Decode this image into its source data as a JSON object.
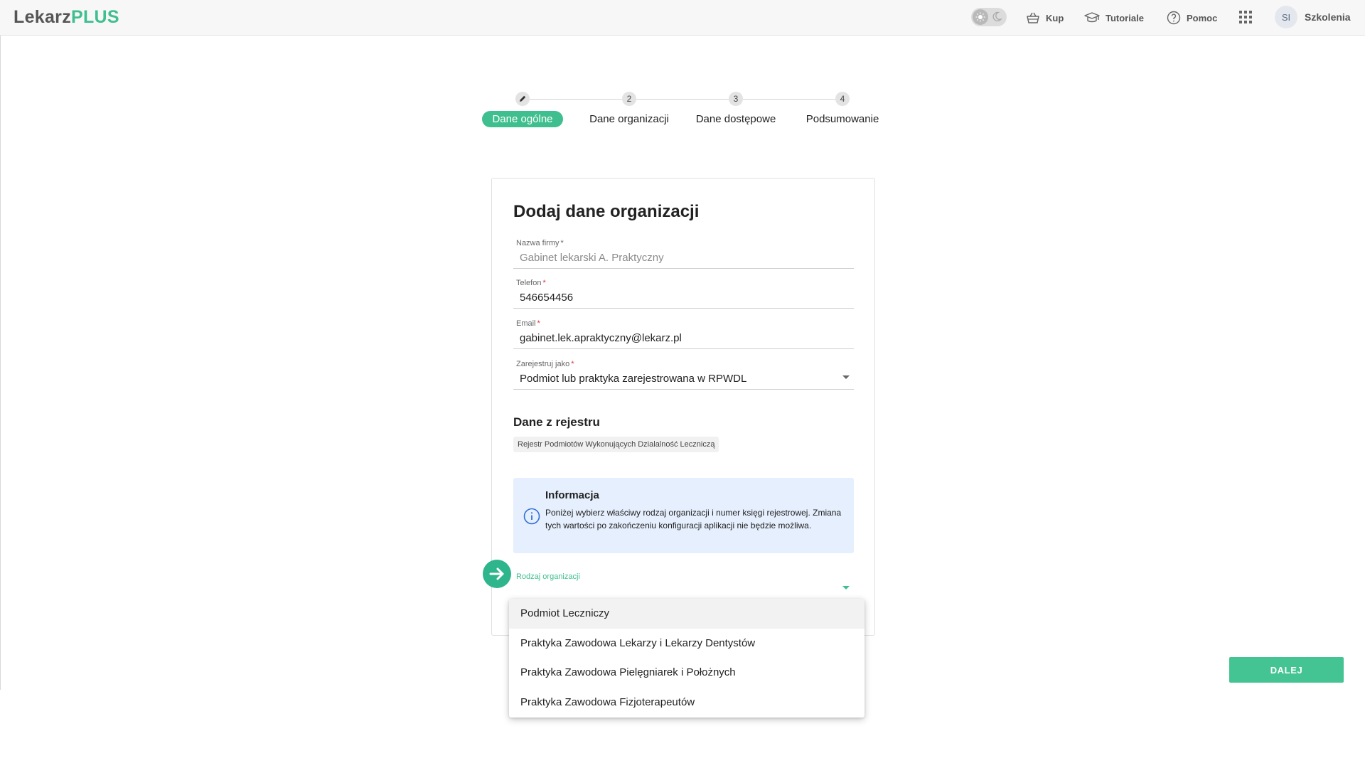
{
  "header": {
    "logo_part1": "Lekarz",
    "logo_part2": "PLUS",
    "nav": [
      {
        "label": "Kup",
        "icon": "basket-icon"
      },
      {
        "label": "Tutoriale",
        "icon": "graduation-cap-icon"
      },
      {
        "label": "Pomoc",
        "icon": "help-circle-icon"
      }
    ],
    "avatar_initials": "SI",
    "user_name": "Szkolenia"
  },
  "stepper": {
    "steps": [
      {
        "number": "",
        "label": "Dane ogólne",
        "active": true,
        "icon": "pencil-icon"
      },
      {
        "number": "2",
        "label": "Dane organizacji",
        "active": false
      },
      {
        "number": "3",
        "label": "Dane dostępowe",
        "active": false
      },
      {
        "number": "4",
        "label": "Podsumowanie",
        "active": false
      }
    ]
  },
  "form": {
    "title": "Dodaj dane organizacji",
    "company_name": {
      "label": "Nazwa firmy",
      "required_mark": "*",
      "value": "Gabinet lekarski A. Praktyczny"
    },
    "phone": {
      "label": "Telefon",
      "required_mark": "*",
      "value": "546654456"
    },
    "email": {
      "label": "Email",
      "required_mark": "*",
      "value": "gabinet.lek.apraktyczny@lekarz.pl"
    },
    "register_as": {
      "label": "Zarejestruj jako",
      "required_mark": "*",
      "value": "Podmiot lub praktyka zarejestrowana w RPWDL"
    },
    "registry_section_title": "Dane z rejestru",
    "registry_chip": "Rejestr Podmiotów Wykonujących Dzialalność Leczniczą",
    "info": {
      "title": "Informacja",
      "text": "Poniżej wybierz właściwy rodzaj organizacji i numer księgi rejestrowej. Zmiana tych wartości po zakończeniu konfiguracji aplikacji nie będzie możliwa."
    },
    "org_type": {
      "label": "Rodzaj organizacji",
      "value": ""
    }
  },
  "dropdown": {
    "options": [
      "Podmiot Leczniczy",
      "Praktyka Zawodowa Lekarzy i Lekarzy Dentystów",
      "Praktyka Zawodowa Pielęgniarek i Położnych",
      "Praktyka Zawodowa Fizjoterapeutów"
    ],
    "highlighted_index": 0
  },
  "actions": {
    "next_label": "DALEJ"
  },
  "colors": {
    "accent": "#3fbf8f",
    "required": "#d9333f",
    "info_bg": "#e6effd"
  }
}
